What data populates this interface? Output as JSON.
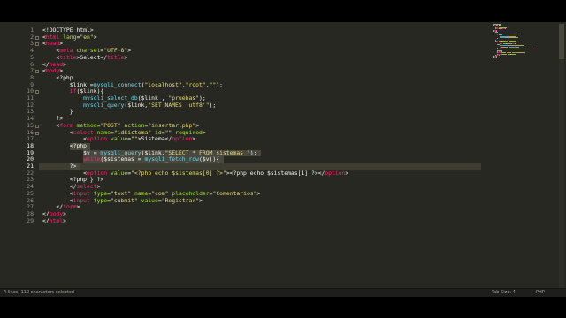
{
  "editor": {
    "lines": [
      {
        "n": "1",
        "tokens": [
          {
            "c": "t-plain",
            "t": "<!DOCTYPE html>"
          }
        ]
      },
      {
        "n": "2",
        "tokens": [
          {
            "c": "t-plain",
            "t": "<"
          },
          {
            "c": "t-tag",
            "t": "html"
          },
          {
            "c": "t-attr",
            "t": " lang"
          },
          {
            "c": "t-plain",
            "t": "="
          },
          {
            "c": "t-str",
            "t": "\"en\""
          },
          {
            "c": "t-plain",
            "t": ">"
          }
        ]
      },
      {
        "n": "3",
        "tokens": [
          {
            "c": "t-plain",
            "t": "<"
          },
          {
            "c": "t-tag",
            "t": "head"
          },
          {
            "c": "t-plain",
            "t": ">"
          }
        ]
      },
      {
        "n": "4",
        "tokens": [
          {
            "c": "t-plain",
            "t": "    <"
          },
          {
            "c": "t-tag",
            "t": "meta"
          },
          {
            "c": "t-attr",
            "t": " charset"
          },
          {
            "c": "t-plain",
            "t": "="
          },
          {
            "c": "t-str",
            "t": "\"UTF-8\""
          },
          {
            "c": "t-plain",
            "t": ">"
          }
        ]
      },
      {
        "n": "5",
        "tokens": [
          {
            "c": "t-plain",
            "t": "    <"
          },
          {
            "c": "t-tag",
            "t": "title"
          },
          {
            "c": "t-plain",
            "t": ">Select</"
          },
          {
            "c": "t-tag",
            "t": "title"
          },
          {
            "c": "t-plain",
            "t": ">"
          }
        ]
      },
      {
        "n": "6",
        "tokens": [
          {
            "c": "t-plain",
            "t": "</"
          },
          {
            "c": "t-tag",
            "t": "head"
          },
          {
            "c": "t-plain",
            "t": ">"
          }
        ]
      },
      {
        "n": "7",
        "tokens": [
          {
            "c": "t-plain",
            "t": "<"
          },
          {
            "c": "t-tag",
            "t": "body"
          },
          {
            "c": "t-plain",
            "t": ">"
          }
        ]
      },
      {
        "n": "8",
        "tokens": [
          {
            "c": "t-plain",
            "t": "    <?php"
          }
        ]
      },
      {
        "n": "9",
        "tokens": [
          {
            "c": "t-plain",
            "t": "        $link ="
          },
          {
            "c": "t-fn",
            "t": "mysqli_connect"
          },
          {
            "c": "t-plain",
            "t": "("
          },
          {
            "c": "t-str",
            "t": "\"localhost\""
          },
          {
            "c": "t-plain",
            "t": ","
          },
          {
            "c": "t-str",
            "t": "\"root\""
          },
          {
            "c": "t-plain",
            "t": ","
          },
          {
            "c": "t-str",
            "t": "\"\""
          },
          {
            "c": "t-plain",
            "t": ");"
          }
        ]
      },
      {
        "n": "10",
        "tokens": [
          {
            "c": "t-plain",
            "t": "        "
          },
          {
            "c": "t-kw",
            "t": "if"
          },
          {
            "c": "t-plain",
            "t": "($link){"
          }
        ]
      },
      {
        "n": "11",
        "tokens": [
          {
            "c": "t-plain",
            "t": "            "
          },
          {
            "c": "t-fn",
            "t": "mysqli_select_db"
          },
          {
            "c": "t-plain",
            "t": "($link , "
          },
          {
            "c": "t-str",
            "t": "\"pruebas\""
          },
          {
            "c": "t-plain",
            "t": ");"
          }
        ]
      },
      {
        "n": "12",
        "tokens": [
          {
            "c": "t-plain",
            "t": "            "
          },
          {
            "c": "t-fn",
            "t": "mysqli_query"
          },
          {
            "c": "t-plain",
            "t": "($link,"
          },
          {
            "c": "t-str",
            "t": "\"SET NAMES 'utf8'\""
          },
          {
            "c": "t-plain",
            "t": ");"
          }
        ]
      },
      {
        "n": "13",
        "tokens": [
          {
            "c": "t-plain",
            "t": "        }"
          }
        ]
      },
      {
        "n": "14",
        "tokens": [
          {
            "c": "t-plain",
            "t": "    ?>"
          }
        ]
      },
      {
        "n": "15",
        "tokens": [
          {
            "c": "t-plain",
            "t": "    <"
          },
          {
            "c": "t-tag",
            "t": "form"
          },
          {
            "c": "t-attr",
            "t": " method"
          },
          {
            "c": "t-plain",
            "t": "="
          },
          {
            "c": "t-str",
            "t": "\"POST\""
          },
          {
            "c": "t-attr",
            "t": " action"
          },
          {
            "c": "t-plain",
            "t": "="
          },
          {
            "c": "t-str",
            "t": "\"insertar.php\""
          },
          {
            "c": "t-plain",
            "t": ">"
          }
        ]
      },
      {
        "n": "16",
        "tokens": [
          {
            "c": "t-plain",
            "t": "        <"
          },
          {
            "c": "t-tag",
            "t": "select"
          },
          {
            "c": "t-attr",
            "t": " name"
          },
          {
            "c": "t-plain",
            "t": "="
          },
          {
            "c": "t-str",
            "t": "\"idSistema\""
          },
          {
            "c": "t-attr",
            "t": " id"
          },
          {
            "c": "t-plain",
            "t": "="
          },
          {
            "c": "t-str",
            "t": "\"\""
          },
          {
            "c": "t-attr",
            "t": " required"
          },
          {
            "c": "t-plain",
            "t": ">"
          }
        ]
      },
      {
        "n": "17",
        "tokens": [
          {
            "c": "t-plain",
            "t": "            <"
          },
          {
            "c": "t-tag",
            "t": "option"
          },
          {
            "c": "t-attr",
            "t": " value"
          },
          {
            "c": "t-plain",
            "t": "="
          },
          {
            "c": "t-str",
            "t": "\"\""
          },
          {
            "c": "t-plain",
            "t": ">Sistema</"
          },
          {
            "c": "t-tag",
            "t": "option"
          },
          {
            "c": "t-plain",
            "t": ">"
          }
        ]
      },
      {
        "n": "18",
        "tokens": [
          {
            "c": "t-plain",
            "t": "        <?php"
          }
        ]
      },
      {
        "n": "19",
        "tokens": [
          {
            "c": "t-plain",
            "t": "            $v = "
          },
          {
            "c": "t-fn",
            "t": "mysqli_query"
          },
          {
            "c": "t-plain",
            "t": "($link,"
          },
          {
            "c": "t-str",
            "t": "\"SELECT * FROM sistemas \""
          },
          {
            "c": "t-plain",
            "t": ");"
          }
        ]
      },
      {
        "n": "20",
        "tokens": [
          {
            "c": "t-plain",
            "t": "            "
          },
          {
            "c": "t-kw",
            "t": "while"
          },
          {
            "c": "t-plain",
            "t": "($sistemas = "
          },
          {
            "c": "t-fn",
            "t": "mysqli_fetch_row"
          },
          {
            "c": "t-plain",
            "t": "($v)){"
          }
        ]
      },
      {
        "n": "21",
        "tokens": [
          {
            "c": "t-plain",
            "t": "        ?>"
          }
        ]
      },
      {
        "n": "22",
        "tokens": [
          {
            "c": "t-plain",
            "t": "            <"
          },
          {
            "c": "t-tag",
            "t": "option"
          },
          {
            "c": "t-attr",
            "t": " value"
          },
          {
            "c": "t-plain",
            "t": "="
          },
          {
            "c": "t-str",
            "t": "\"<?php echo $sistemas[0] ?>\""
          },
          {
            "c": "t-plain",
            "t": "><?php echo $sistemas[1] ?></"
          },
          {
            "c": "t-tag",
            "t": "option"
          },
          {
            "c": "t-plain",
            "t": ">"
          }
        ]
      },
      {
        "n": "23",
        "tokens": [
          {
            "c": "t-plain",
            "t": "        <?php } ?>"
          }
        ]
      },
      {
        "n": "24",
        "tokens": [
          {
            "c": "t-plain",
            "t": "        </"
          },
          {
            "c": "t-tag",
            "t": "select"
          },
          {
            "c": "t-plain",
            "t": ">"
          }
        ]
      },
      {
        "n": "25",
        "tokens": [
          {
            "c": "t-plain",
            "t": "        <"
          },
          {
            "c": "t-tag",
            "t": "input"
          },
          {
            "c": "t-attr",
            "t": " type"
          },
          {
            "c": "t-plain",
            "t": "="
          },
          {
            "c": "t-str",
            "t": "\"text\""
          },
          {
            "c": "t-attr",
            "t": " name"
          },
          {
            "c": "t-plain",
            "t": "="
          },
          {
            "c": "t-str",
            "t": "\"com\""
          },
          {
            "c": "t-attr",
            "t": " placeholder"
          },
          {
            "c": "t-plain",
            "t": "="
          },
          {
            "c": "t-str",
            "t": "\"Comentarios\""
          },
          {
            "c": "t-plain",
            "t": ">"
          }
        ]
      },
      {
        "n": "26",
        "tokens": [
          {
            "c": "t-plain",
            "t": "        <"
          },
          {
            "c": "t-tag",
            "t": "input"
          },
          {
            "c": "t-attr",
            "t": " type"
          },
          {
            "c": "t-plain",
            "t": "="
          },
          {
            "c": "t-str",
            "t": "\"submit\""
          },
          {
            "c": "t-attr",
            "t": " value"
          },
          {
            "c": "t-plain",
            "t": "="
          },
          {
            "c": "t-str",
            "t": "\"Registrar\""
          },
          {
            "c": "t-plain",
            "t": ">"
          }
        ]
      },
      {
        "n": "27",
        "tokens": [
          {
            "c": "t-plain",
            "t": "    </"
          },
          {
            "c": "t-tag",
            "t": "form"
          },
          {
            "c": "t-plain",
            "t": ">"
          }
        ]
      },
      {
        "n": "28",
        "tokens": [
          {
            "c": "t-plain",
            "t": "</"
          },
          {
            "c": "t-tag",
            "t": "body"
          },
          {
            "c": "t-plain",
            "t": ">"
          }
        ]
      },
      {
        "n": "29",
        "tokens": [
          {
            "c": "t-plain",
            "t": "</"
          },
          {
            "c": "t-tag",
            "t": "html"
          },
          {
            "c": "t-plain",
            "t": ">"
          }
        ]
      }
    ],
    "selected_lines": [
      "18",
      "19",
      "20",
      "21"
    ],
    "cursor_line": "21"
  },
  "status_bar": {
    "left_text": "4 lines, 110 characters selected",
    "tab_size": "Tab Size: 4",
    "syntax": "PHP"
  },
  "colors": {
    "background": "#272822",
    "selection": "#49483e",
    "tag": "#f92672",
    "attribute": "#a6e22e",
    "string": "#e6db74",
    "function": "#66d9ef"
  }
}
